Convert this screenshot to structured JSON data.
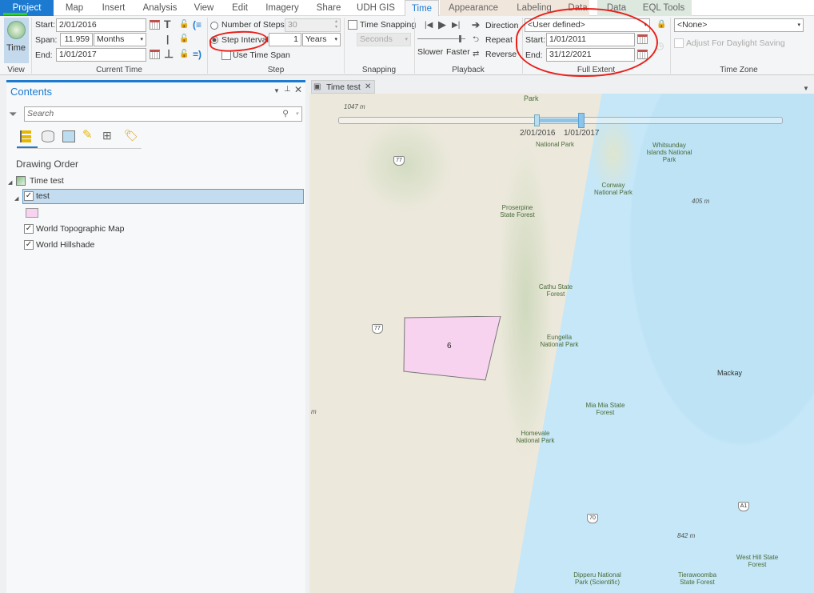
{
  "tabs": [
    {
      "label": "Project"
    },
    {
      "label": "Map"
    },
    {
      "label": "Insert"
    },
    {
      "label": "Analysis"
    },
    {
      "label": "View"
    },
    {
      "label": "Edit"
    },
    {
      "label": "Imagery"
    },
    {
      "label": "Share"
    },
    {
      "label": "UDH GIS"
    },
    {
      "label": "Time"
    },
    {
      "label": "Appearance"
    },
    {
      "label": "Labeling"
    },
    {
      "label": "Data"
    },
    {
      "label": "Data"
    },
    {
      "label": "EQL Tools"
    }
  ],
  "ribbon": {
    "view": {
      "button": "Time",
      "group": "View"
    },
    "current_time": {
      "start_label": "Start:",
      "start": "2/01/2016",
      "span_label": "Span:",
      "span": "11.959",
      "span_unit": "Months",
      "end_label": "End:",
      "end": "1/01/2017",
      "group": "Current Time"
    },
    "step": {
      "num_steps_label": "Number of Steps:",
      "num_steps": "30",
      "step_interval_label": "Step Interval:",
      "step_interval": "1",
      "step_unit": "Years",
      "use_time_span": "Use Time Span",
      "group": "Step"
    },
    "snapping": {
      "label": "Time Snapping",
      "unit": "Seconds",
      "group": "Snapping"
    },
    "playback": {
      "direction": "Direction",
      "repeat": "Repeat",
      "reverse": "Reverse",
      "slower": "Slower",
      "faster": "Faster",
      "group": "Playback"
    },
    "full_extent": {
      "preset": "<User defined>",
      "start_label": "Start:",
      "start": "1/01/2011",
      "end_label": "End:",
      "end": "31/12/2021",
      "group": "Full Extent"
    },
    "time_zone": {
      "value": "<None>",
      "daylight": "Adjust For Daylight Saving",
      "group": "Time Zone"
    }
  },
  "contents": {
    "title": "Contents",
    "search_placeholder": "Search",
    "heading": "Drawing Order",
    "layers": {
      "map": "Time test",
      "test": "test",
      "topo": "World Topographic Map",
      "hillshade": "World Hillshade"
    }
  },
  "map_view": {
    "tab": "Time test",
    "slider_start": "2/01/2016",
    "slider_end": "1/01/2017",
    "polygon_label": "6",
    "labels": {
      "park_top": "Park",
      "elev1": "1047 m",
      "dryander": "National Park",
      "whitsunday": "Whitsunday Islands National Park",
      "conway": "Conway National Park",
      "elev2": "405 m",
      "proserpine": "Proserpine State Forest",
      "cathu": "Cathu State Forest",
      "eungella": "Eungella National Park",
      "mackay": "Mackay",
      "miamia": "Mia Mia State Forest",
      "homevale": "Homevale National Park",
      "westhill": "West Hill State Forest",
      "elev3": "842 m",
      "dipperu": "Dipperu National Park (Scientific)",
      "tierawoomba": "Tierawoomba State Forest",
      "m": "m"
    },
    "shields": {
      "r77a": "77",
      "r77b": "77",
      "r70": "70",
      "a1": "A1"
    }
  }
}
